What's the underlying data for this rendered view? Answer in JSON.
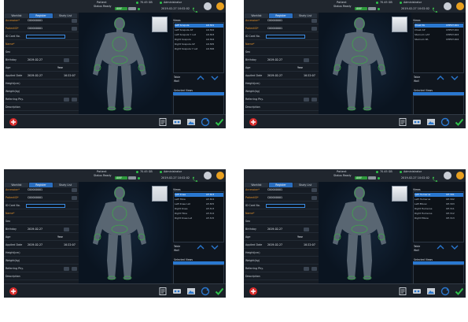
{
  "header": {
    "title": "Patient",
    "status_label": "Status",
    "status_value": "Ready",
    "size_value": "70.45 GB",
    "user": "Administrator",
    "badge": "ANY",
    "datetime": "2019-02-27 10:02:02"
  },
  "tabs": [
    "Worklist",
    "Register",
    "Study List"
  ],
  "form": {
    "fields": [
      {
        "label": "Accession*",
        "value": "C00000001",
        "required": true
      },
      {
        "label": "PatientID*",
        "value": "C00000001",
        "required": true
      },
      {
        "label": "ID Card No.",
        "value": "",
        "required": false
      },
      {
        "label": "Name*",
        "value": "",
        "required": true
      },
      {
        "label": "Sex",
        "value": "",
        "required": false
      },
      {
        "label": "Birthday",
        "value": "2019-02-27",
        "required": false
      },
      {
        "label": "Age",
        "value": "Year",
        "required": false
      },
      {
        "label": "Applied Date",
        "value": "2019-02-27",
        "extra": "10:22:07",
        "required": false
      },
      {
        "label": "Height(cm)",
        "value": "",
        "required": false
      },
      {
        "label": "Weight(kg)",
        "value": "",
        "required": false
      },
      {
        "label": "Referring Phy.",
        "value": "",
        "required": false
      },
      {
        "label": "Description",
        "value": "",
        "required": false
      }
    ]
  },
  "views": {
    "header": "Views",
    "checks": [
      "Table",
      "Wall"
    ],
    "selected_header": "Selected Views"
  },
  "panels": [
    {
      "items": [
        {
          "name": "Left Scapula",
          "code": "LR.301",
          "selected": true
        },
        {
          "name": "Left Scapula AP",
          "code": "LR.302"
        },
        {
          "name": "Left Scapula Y Lat",
          "code": "LR.303"
        },
        {
          "name": "Right Scapula",
          "code": "LR.304"
        },
        {
          "name": "Right Scapula AP",
          "code": "LR.305"
        },
        {
          "name": "Right Scapula Y Lat",
          "code": "LR.306"
        }
      ]
    },
    {
      "items": [
        {
          "name": "Chest PA",
          "code": "CHEST.001",
          "selected": true
        },
        {
          "name": "Chest AP",
          "code": "CHEST.002"
        },
        {
          "name": "Sternum LAT",
          "code": "CHEST.003"
        },
        {
          "name": "Sternum PA",
          "code": "CHEST.004"
        }
      ]
    },
    {
      "items": [
        {
          "name": "Left Knee",
          "code": "LE.303",
          "selected": true
        },
        {
          "name": "Left Tibia",
          "code": "LE.304"
        },
        {
          "name": "Left Knee Lat",
          "code": "LE.305"
        },
        {
          "name": "Right Knee",
          "code": "LE.313"
        },
        {
          "name": "Right Tibia",
          "code": "LE.314"
        },
        {
          "name": "Right Knee Lat",
          "code": "LE.315"
        }
      ]
    },
    {
      "items": [
        {
          "name": "Left Humerus",
          "code": "UE.301",
          "selected": true
        },
        {
          "name": "Left Humerus",
          "code": "UE.302"
        },
        {
          "name": "Left Elbow",
          "code": "UE.303"
        },
        {
          "name": "Right Humerus",
          "code": "UE.311"
        },
        {
          "name": "Right Humerus",
          "code": "UE.312"
        },
        {
          "name": "Right Elbow",
          "code": "UE.313"
        }
      ]
    }
  ],
  "colors": {
    "accent": "#2a78d0",
    "required": "#e0902b",
    "ok": "#2ec24a",
    "highlight": "#f0f0f0"
  },
  "icons": [
    "add-red-icon",
    "report-icon",
    "tape-icon",
    "image-icon",
    "refresh-icon",
    "check-icon"
  ]
}
